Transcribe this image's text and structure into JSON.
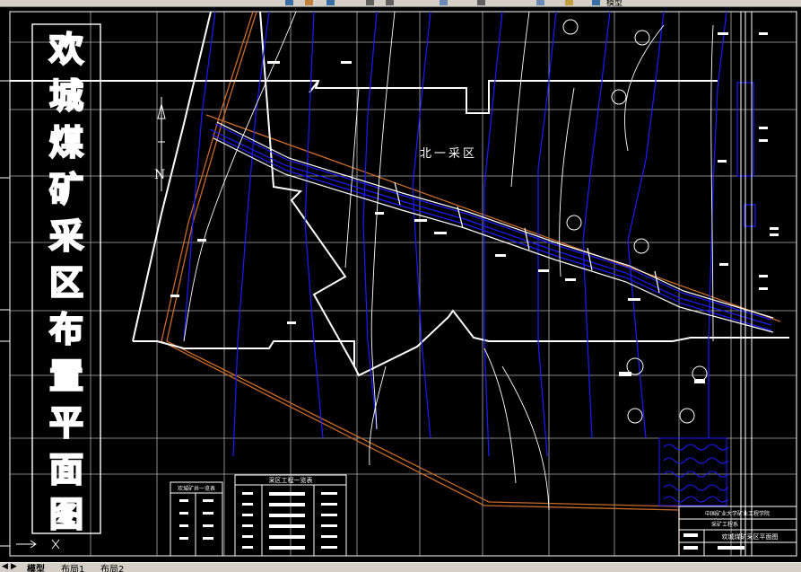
{
  "toolbar": {
    "label": "模型"
  },
  "drawing": {
    "title_vertical": [
      "欢",
      "城",
      "煤",
      "矿",
      "采",
      "区",
      "布",
      "置",
      "平",
      "面",
      "图"
    ],
    "north_label": "N",
    "area_label": "北一采区",
    "table1_title": "欢城矿井一览表",
    "table2_title": "采区工程一览表",
    "title_block": {
      "school": "中国矿业大学矿业工程学院",
      "dept": "采矿工程系",
      "name": "欢城煤矿采区平面图"
    }
  },
  "statusbar": {
    "tabs": [
      "模型",
      "布局1",
      "布局2"
    ],
    "active_tab": 0
  },
  "colors": {
    "background": "#000000",
    "grid": "#ffffff",
    "roadway_blue": "#1c1cff",
    "boundary_orange": "#c86a2a",
    "ui_gray": "#d4d0c8"
  }
}
